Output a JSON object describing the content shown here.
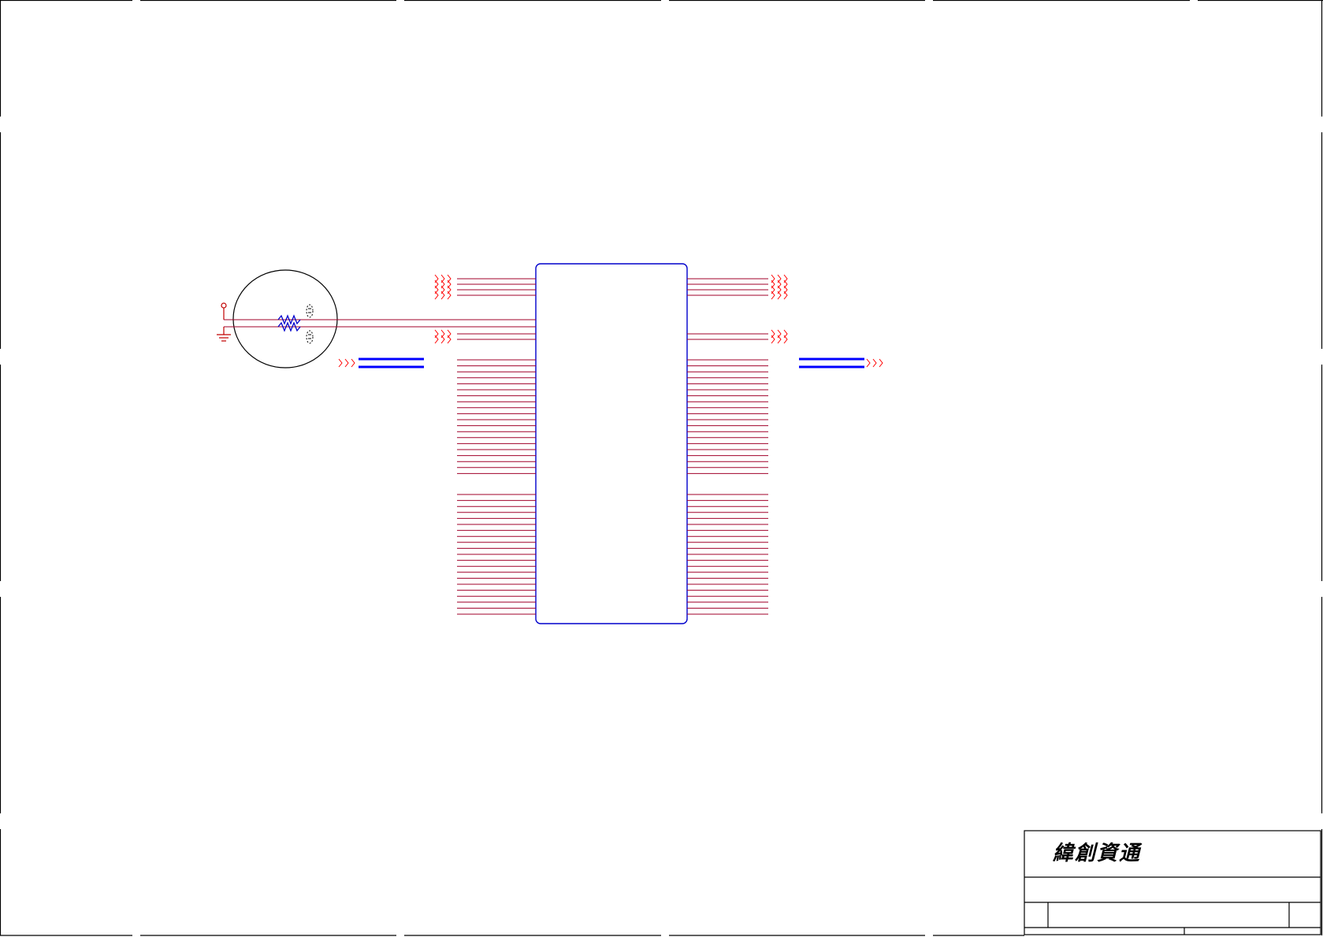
{
  "title_block": {
    "company_name": "緯創資通"
  },
  "colors": {
    "background": "#ffffff",
    "border": "#000000",
    "net_wire": "#a0002a",
    "component": "#0000cc",
    "off_page": "#ff0000",
    "bus": "#0000ff",
    "outline": "#000000"
  },
  "ic": {
    "left_pins": 40,
    "right_pins": 40
  },
  "icons": [
    "off-page-connector-icon",
    "ground-symbol-icon",
    "power-pin-icon",
    "resistor-icon",
    "capacitor-icon"
  ]
}
